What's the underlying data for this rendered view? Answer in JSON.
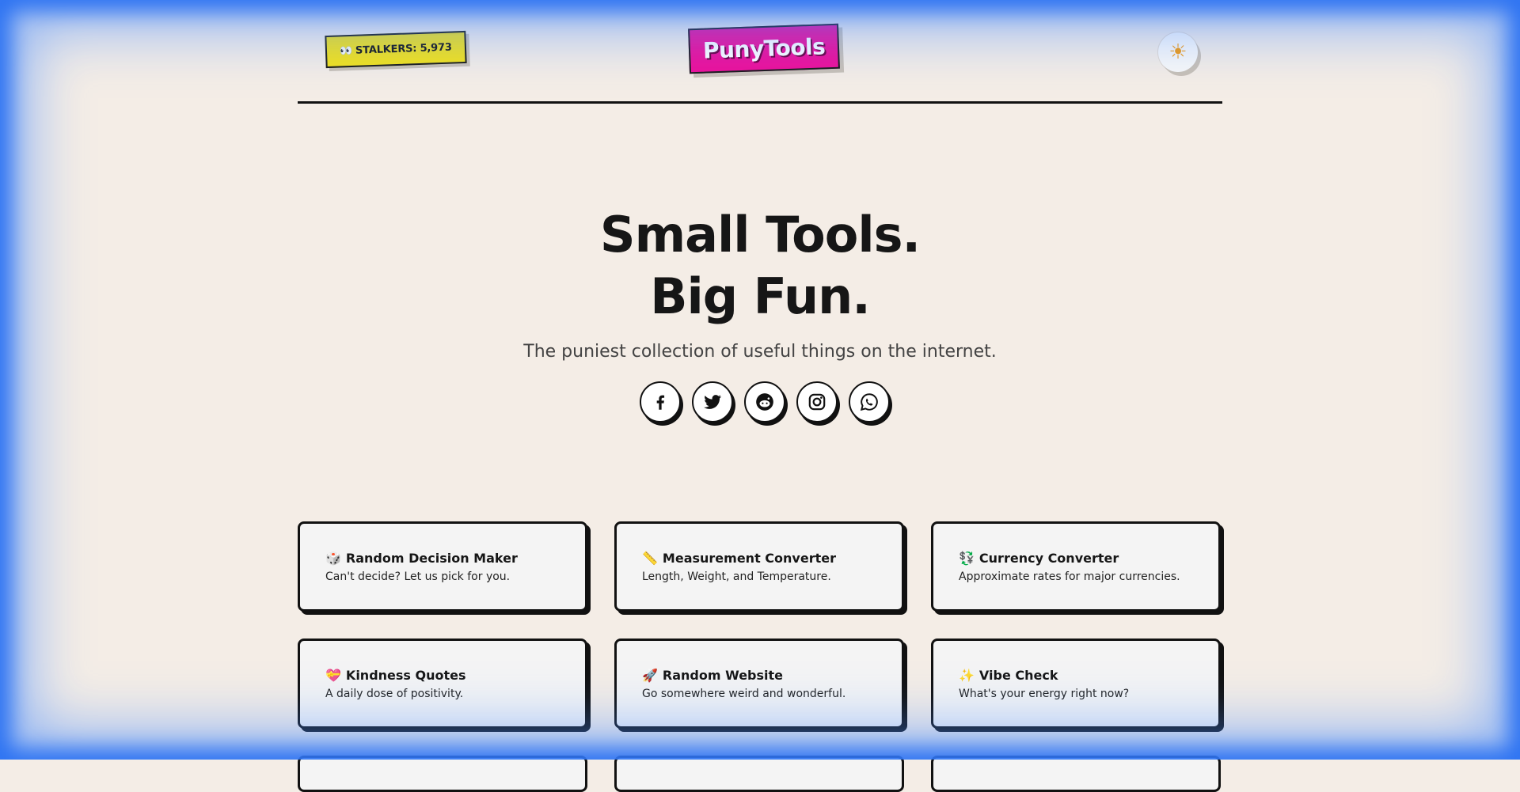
{
  "header": {
    "stalkers_icon": "👀",
    "stalkers_label": "STALKERS: 5,973",
    "logo": "PunyTools",
    "theme_icon": "☀"
  },
  "hero": {
    "line1": "Small Tools.",
    "line2": "Big Fun.",
    "subtitle": "The puniest collection of useful things on the internet."
  },
  "social": [
    {
      "name": "facebook-icon"
    },
    {
      "name": "twitter-icon"
    },
    {
      "name": "reddit-icon"
    },
    {
      "name": "instagram-icon"
    },
    {
      "name": "whatsapp-icon"
    }
  ],
  "tools": [
    {
      "emoji": "🎲",
      "title": "Random Decision Maker",
      "desc": "Can't decide? Let us pick for you."
    },
    {
      "emoji": "📏",
      "title": "Measurement Converter",
      "desc": "Length, Weight, and Temperature."
    },
    {
      "emoji": "💱",
      "title": "Currency Converter",
      "desc": "Approximate rates for major currencies."
    },
    {
      "emoji": "💝",
      "title": "Kindness Quotes",
      "desc": "A daily dose of positivity."
    },
    {
      "emoji": "🚀",
      "title": "Random Website",
      "desc": "Go somewhere weird and wonderful."
    },
    {
      "emoji": "✨",
      "title": "Vibe Check",
      "desc": "What's your energy right now?"
    }
  ],
  "colors": {
    "background": "#f4ede6",
    "logo_bg": "#ee0f9a",
    "badge_bg": "#f3e21c",
    "frame_glow": "#2d73f2"
  }
}
